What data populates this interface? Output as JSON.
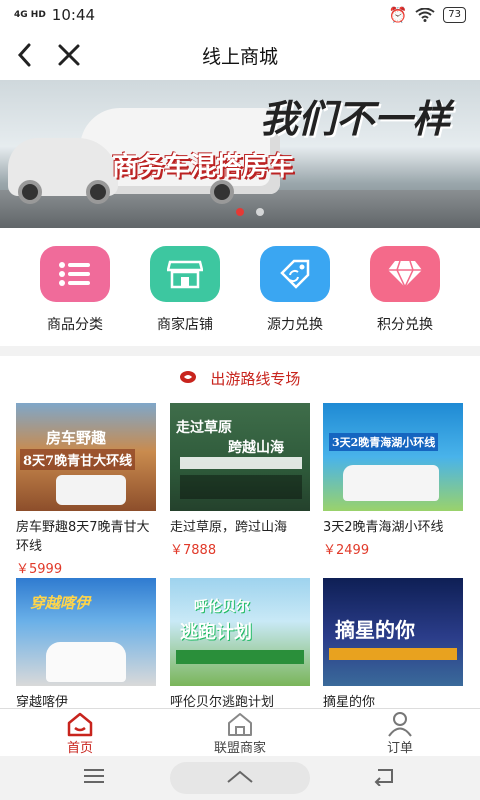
{
  "status": {
    "signal_label": "4G HD",
    "time": "10:44",
    "battery": "73"
  },
  "header": {
    "title": "线上商城"
  },
  "banner": {
    "slogan_top": "我们不一样",
    "slogan_main": "商务车混搭房车",
    "active_index": 0,
    "count": 2
  },
  "quick_actions": [
    {
      "label": "商品分类",
      "icon": "list-icon",
      "color": "#f06b9a"
    },
    {
      "label": "商家店铺",
      "icon": "store-icon",
      "color": "#3dc7a0"
    },
    {
      "label": "源力兑换",
      "icon": "exchange-tag-icon",
      "color": "#3aa6f2"
    },
    {
      "label": "积分兑换",
      "icon": "diamond-icon",
      "color": "#f46a8a"
    }
  ],
  "section": {
    "title": "出游路线专场",
    "products": [
      {
        "name": "房车野趣8天7晚青甘大环线",
        "price": "￥5999",
        "thumb_title": "房车野趣",
        "thumb_sub": "8天7晚青甘大环线"
      },
      {
        "name": "走过草原，跨过山海",
        "price": "￥7888",
        "thumb_title": "走过草原",
        "thumb_sub": "跨越山海"
      },
      {
        "name": "3天2晚青海湖小环线",
        "price": "￥2499",
        "thumb_title": "3天2晚青海湖小环线",
        "thumb_sub": ""
      },
      {
        "name": "穿越喀伊",
        "price": "",
        "thumb_title": "穿越喀伊",
        "thumb_sub": ""
      },
      {
        "name": "呼伦贝尔逃跑计划",
        "price": "",
        "thumb_title": "呼伦贝尔",
        "thumb_sub": "逃跑计划"
      },
      {
        "name": "摘星的你",
        "price": "",
        "thumb_title": "摘星的你",
        "thumb_sub": ""
      }
    ]
  },
  "tabs": [
    {
      "label": "首页",
      "active": true
    },
    {
      "label": "联盟商家",
      "active": false
    },
    {
      "label": "订单",
      "active": false
    }
  ],
  "colors": {
    "accent": "#c8241d",
    "price": "#e13a2a"
  }
}
